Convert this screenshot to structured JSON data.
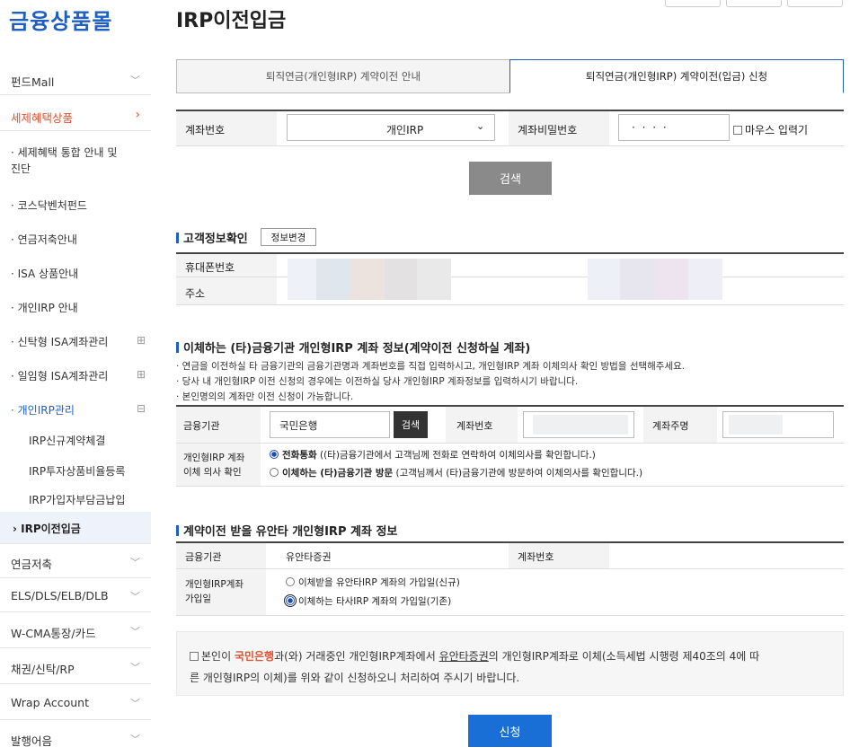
{
  "brand": "금융상품몰",
  "page_title": "IRP이전입금",
  "sidebar": {
    "items": [
      {
        "label": "펀드Mall",
        "icon": "chevron-down-icon"
      },
      {
        "label": "세제혜택상품",
        "icon": "chevron-right-icon",
        "active": true
      },
      {
        "label": "연금저축",
        "icon": "chevron-down-icon"
      },
      {
        "label": "ELS/DLS/ELB/DLB",
        "icon": "chevron-down-icon"
      },
      {
        "label": "W-CMA통장/카드",
        "icon": "chevron-down-icon"
      },
      {
        "label": "채권/신탁/RP",
        "icon": "chevron-down-icon"
      },
      {
        "label": "Wrap Account",
        "icon": "chevron-down-icon"
      },
      {
        "label": "발행어음",
        "icon": "chevron-down-icon"
      }
    ],
    "subitems": [
      {
        "label": "· 세제혜택 통합 안내 및"
      },
      {
        "label": "진단"
      },
      {
        "label": "· 코스닥벤처펀드"
      },
      {
        "label": "· 연금저축안내"
      },
      {
        "label": "· ISA 상품안내"
      },
      {
        "label": "· 개인IRP 안내"
      },
      {
        "label": "· 신탁형 ISA계좌관리",
        "icon": "plus-box-icon"
      },
      {
        "label": "· 일임형 ISA계좌관리",
        "icon": "plus-box-icon"
      },
      {
        "label": "· 개인IRP관리",
        "icon": "minus-box-icon"
      }
    ],
    "irp_children": [
      "IRP신규계약체결",
      "IRP투자상품비율등록",
      "IRP가입자부담금납입",
      "› IRP이전입금"
    ]
  },
  "tabs": [
    "퇴직연금(개인형IRP) 계약이전 안내",
    "퇴직연금(개인형IRP) 계약이전(입금) 신청"
  ],
  "search_form": {
    "account_label": "계좌번호",
    "account_type": "개인IRP",
    "password_label": "계좌비밀번호",
    "password_value": "· · · ·",
    "mouse_input_label": "마우스 입력기",
    "search_button": "검색"
  },
  "customer_section": {
    "title": "고객정보확인",
    "edit_button": "정보변경",
    "phone_label": "휴대폰번호",
    "address_label": "주소"
  },
  "transfer_section": {
    "title": "이체하는 (타)금융기관 개인형IRP 계좌 정보(계약이전 신청하실 계좌)",
    "notes": [
      "· 연금을 이전하실 타 금융기관의 금융기관명과 계좌번호를 직접 입력하시고, 개인형IRP 계좌 이체의사 확인 방법을 선택해주세요.",
      "· 당사 내 개인형IRP 이전 신청의 경우에는 이전하실 당사 개인형IRP 계좌정보를 입력하시기 바랍니다.",
      "· 본인명의의 계좌만 이전 신청이 가능합니다."
    ],
    "institution_label": "금융기관",
    "institution_value": "국민은행",
    "search_button": "검색",
    "account_label": "계좌번호",
    "owner_label": "계좌주명",
    "confirm_label_1": "개인형IRP 계좌",
    "confirm_label_2": "이체 의사 확인",
    "option1_bold": "전화통화",
    "option1_text": " ((타)금융기관에서 고객님께 전화로 연락하여 이체의사를 확인합니다.)",
    "option2_bold": "이체하는 (타)금융기관 방문",
    "option2_text": " (고객님께서 (타)금융기관에 방문하여 이체의사를 확인합니다.)"
  },
  "receive_section": {
    "title": "계약이전 받을 유안타 개인형IRP 계좌 정보",
    "institution_label": "금융기관",
    "institution_value": "유안타증권",
    "account_label": "계좌번호",
    "join_label_1": "개인형IRP계좌",
    "join_label_2": "가입일",
    "option1": "이체받을 유안타IRP 계좌의 가입일(신규)",
    "option2": "이체하는 타사IRP 계좌의 가입일(기존)"
  },
  "agreement": {
    "p1": "본인이 ",
    "bank": "국민은행",
    "p2": "과(와) 거래중인 개인형IRP계좌에서 ",
    "company": "유안타증권",
    "p3": "의 개인형IRP계좌로 이체(소득세법 시행령 제40조의 4에 따",
    "line2": "른 개인형IRP의 이체)를 위와 같이 신청하오니 처리하여 주시기 바랍니다."
  },
  "submit_button": "신청",
  "colors": {
    "brand": "#1f5fbf",
    "active_menu": "#e0512f",
    "button_blue": "#1a6fd6",
    "button_gray": "#8a8a8a"
  }
}
